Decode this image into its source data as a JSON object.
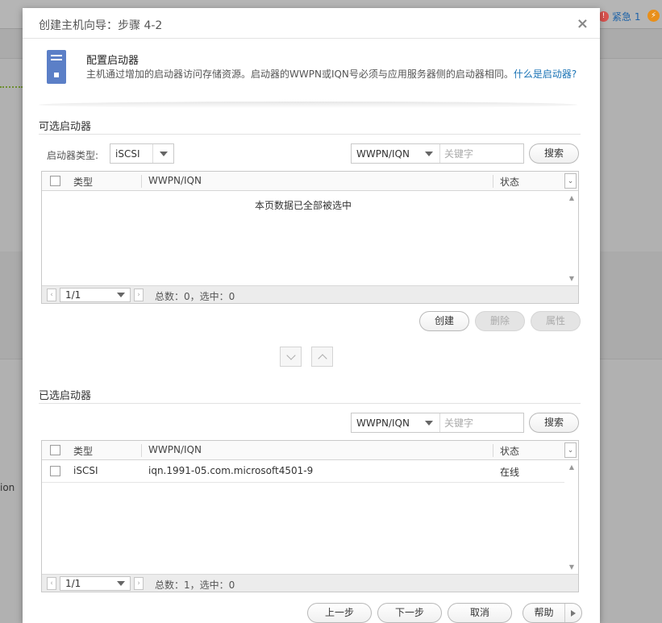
{
  "background": {
    "alert_count_label": "紧急 1",
    "fragment_text": "ion"
  },
  "dialog": {
    "title": "创建主机向导：步骤 4-2",
    "close_glyph": "×",
    "intro": {
      "heading": "配置启动器",
      "description": "主机通过增加的启动器访问存储资源。启动器的WWPN或IQN号必须与应用服务器侧的启动器相同。",
      "help_link": "什么是启动器?"
    },
    "available": {
      "section_title": "可选启动器",
      "type_label": "启动器类型:",
      "type_value": "iSCSI",
      "search_field": "WWPN/IQN",
      "search_placeholder": "关键字",
      "search_button": "搜索",
      "columns": {
        "type": "类型",
        "wwpn": "WWPN/IQN",
        "status": "状态"
      },
      "empty_message": "本页数据已全部被选中",
      "pager": {
        "page": "1/1",
        "summary": "总数：0，选中：0"
      },
      "actions": {
        "create": "创建",
        "delete": "删除",
        "properties": "属性"
      }
    },
    "selected": {
      "section_title": "已选启动器",
      "search_field": "WWPN/IQN",
      "search_placeholder": "关键字",
      "search_button": "搜索",
      "columns": {
        "type": "类型",
        "wwpn": "WWPN/IQN",
        "status": "状态"
      },
      "rows": [
        {
          "type": "iSCSI",
          "wwpn": "iqn.1991-05.com.microsoft4501-9",
          "status": "在线"
        }
      ],
      "pager": {
        "page": "1/1",
        "summary": "总数：1，选中：0"
      }
    },
    "footer": {
      "prev": "上一步",
      "next": "下一步",
      "cancel": "取消",
      "help": "帮助"
    }
  }
}
